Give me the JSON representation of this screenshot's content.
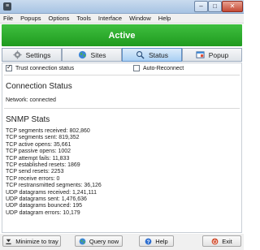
{
  "window": {
    "title": "",
    "minimize_glyph": "–",
    "maximize_glyph": "□",
    "close_glyph": "✕",
    "app_glyph": "≡"
  },
  "menu": [
    "File",
    "Popups",
    "Options",
    "Tools",
    "Interface",
    "Window",
    "Help"
  ],
  "status_banner": {
    "text": "Active",
    "color": "#2aa82a"
  },
  "tabs": [
    {
      "label": "Settings",
      "icon": "gears-icon"
    },
    {
      "label": "Sites",
      "icon": "globe-icon"
    },
    {
      "label": "Status",
      "icon": "magnifier-icon",
      "active": true
    },
    {
      "label": "Popup",
      "icon": "popup-window-icon"
    }
  ],
  "options": {
    "trust_connection": {
      "label": "Trust connection status",
      "checked": true
    },
    "auto_reconnect": {
      "label": "Auto-Reconnect",
      "checked": false
    }
  },
  "connection": {
    "heading": "Connection Status",
    "network_line": "Network: connected"
  },
  "snmp": {
    "heading": "SNMP Stats",
    "lines": [
      "TCP segments received: 802,860",
      "TCP segments sent: 819,352",
      "TCP active opens: 35,661",
      "TCP passive opens: 1002",
      "TCP attempt fails: 11,833",
      "TCP established resets: 1869",
      "TCP send resets: 2253",
      "TCP receive errors: 0",
      "TCP restransmitted segments: 36,126",
      "UDP datagrams received: 1,241,111",
      "UDP datagrams sent: 1,476,636",
      "UDP datagrams bounced: 195",
      "UDP datagram errors: 10,179"
    ]
  },
  "bottom_buttons": {
    "minimize": {
      "label": "Minimize to tray",
      "icon": "tray-down-icon"
    },
    "query": {
      "label": "Query now",
      "icon": "globe-icon"
    },
    "help": {
      "label": "Help",
      "icon": "help-icon"
    },
    "exit": {
      "label": "Exit",
      "icon": "power-icon"
    }
  },
  "colors": {
    "accent": "#2aa82a",
    "tab_active": "#a9cff3",
    "exit_icon": "#d24a2a",
    "help_icon": "#2f6fd0"
  }
}
